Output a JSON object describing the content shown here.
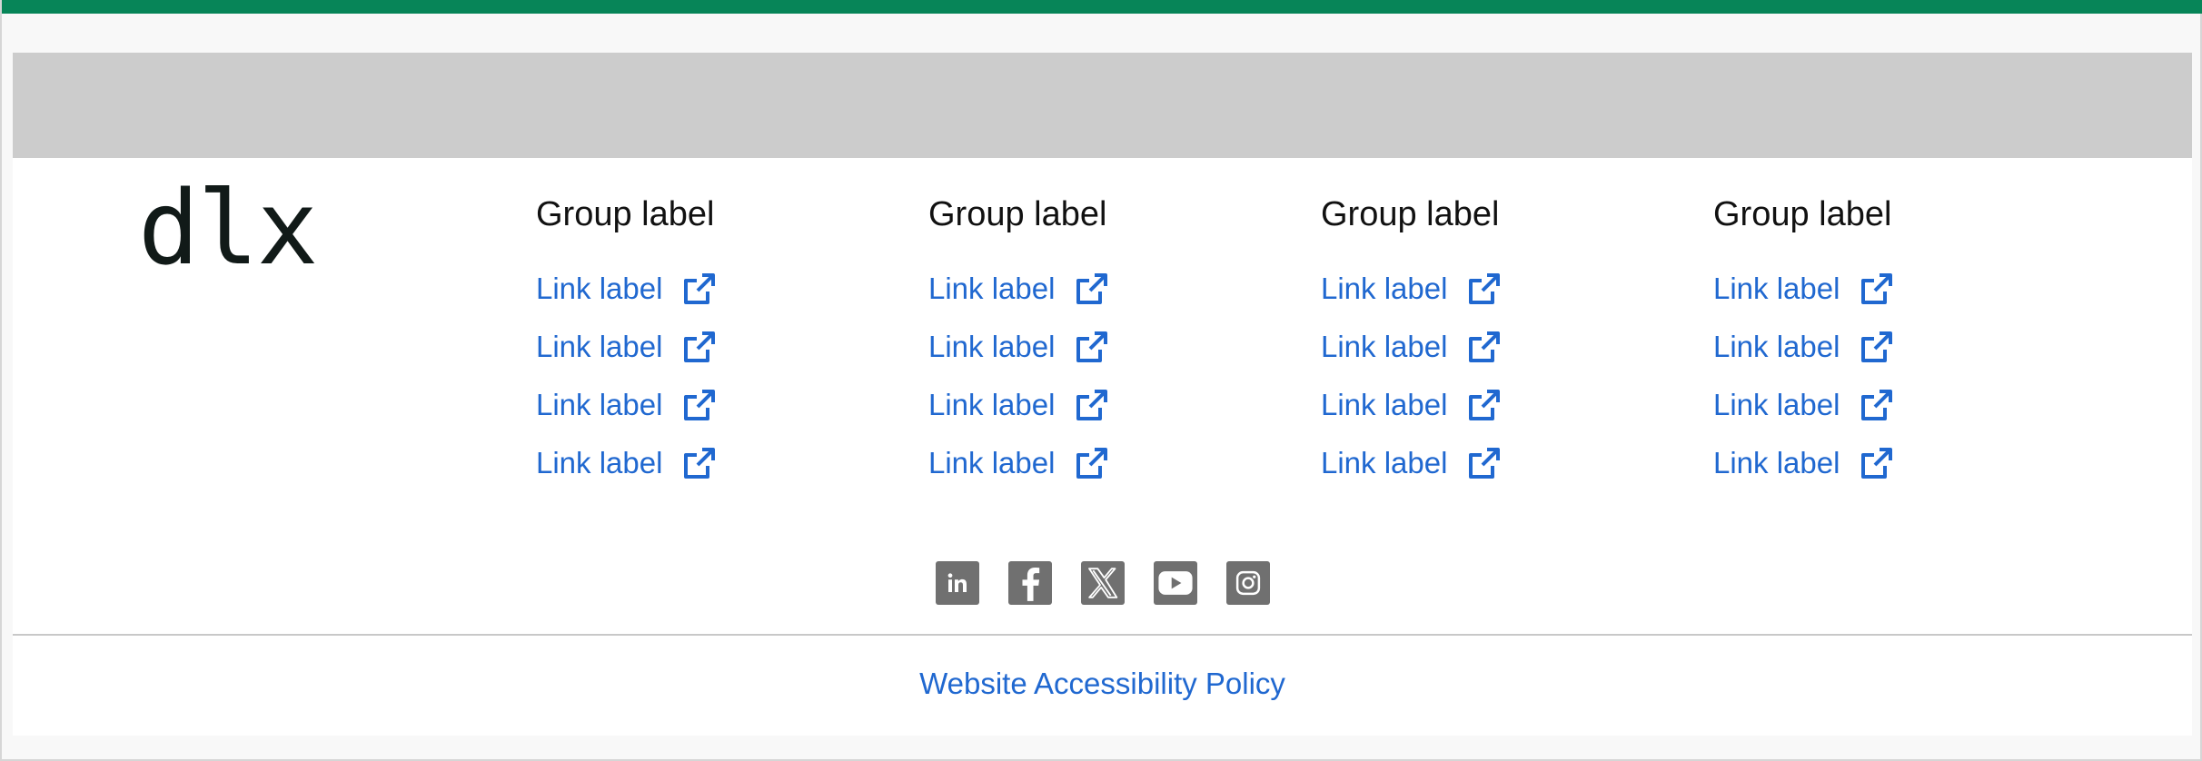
{
  "colors": {
    "top_bar": "#078558",
    "banner": "#cccccc",
    "link": "#2068d0",
    "social_icon_bg": "#707070"
  },
  "footer": {
    "logo_text": "dlx",
    "groups": [
      {
        "label": "Group label",
        "links": [
          "Link label",
          "Link label",
          "Link label",
          "Link label"
        ]
      },
      {
        "label": "Group label",
        "links": [
          "Link label",
          "Link label",
          "Link label",
          "Link label"
        ]
      },
      {
        "label": "Group label",
        "links": [
          "Link label",
          "Link label",
          "Link label",
          "Link label"
        ]
      },
      {
        "label": "Group label",
        "links": [
          "Link label",
          "Link label",
          "Link label",
          "Link label"
        ]
      }
    ],
    "link_icon": "external-link-icon",
    "social_icons": [
      "linkedin-icon",
      "facebook-icon",
      "x-twitter-icon",
      "youtube-icon",
      "instagram-icon"
    ],
    "policy_link": "Website Accessibility Policy"
  }
}
